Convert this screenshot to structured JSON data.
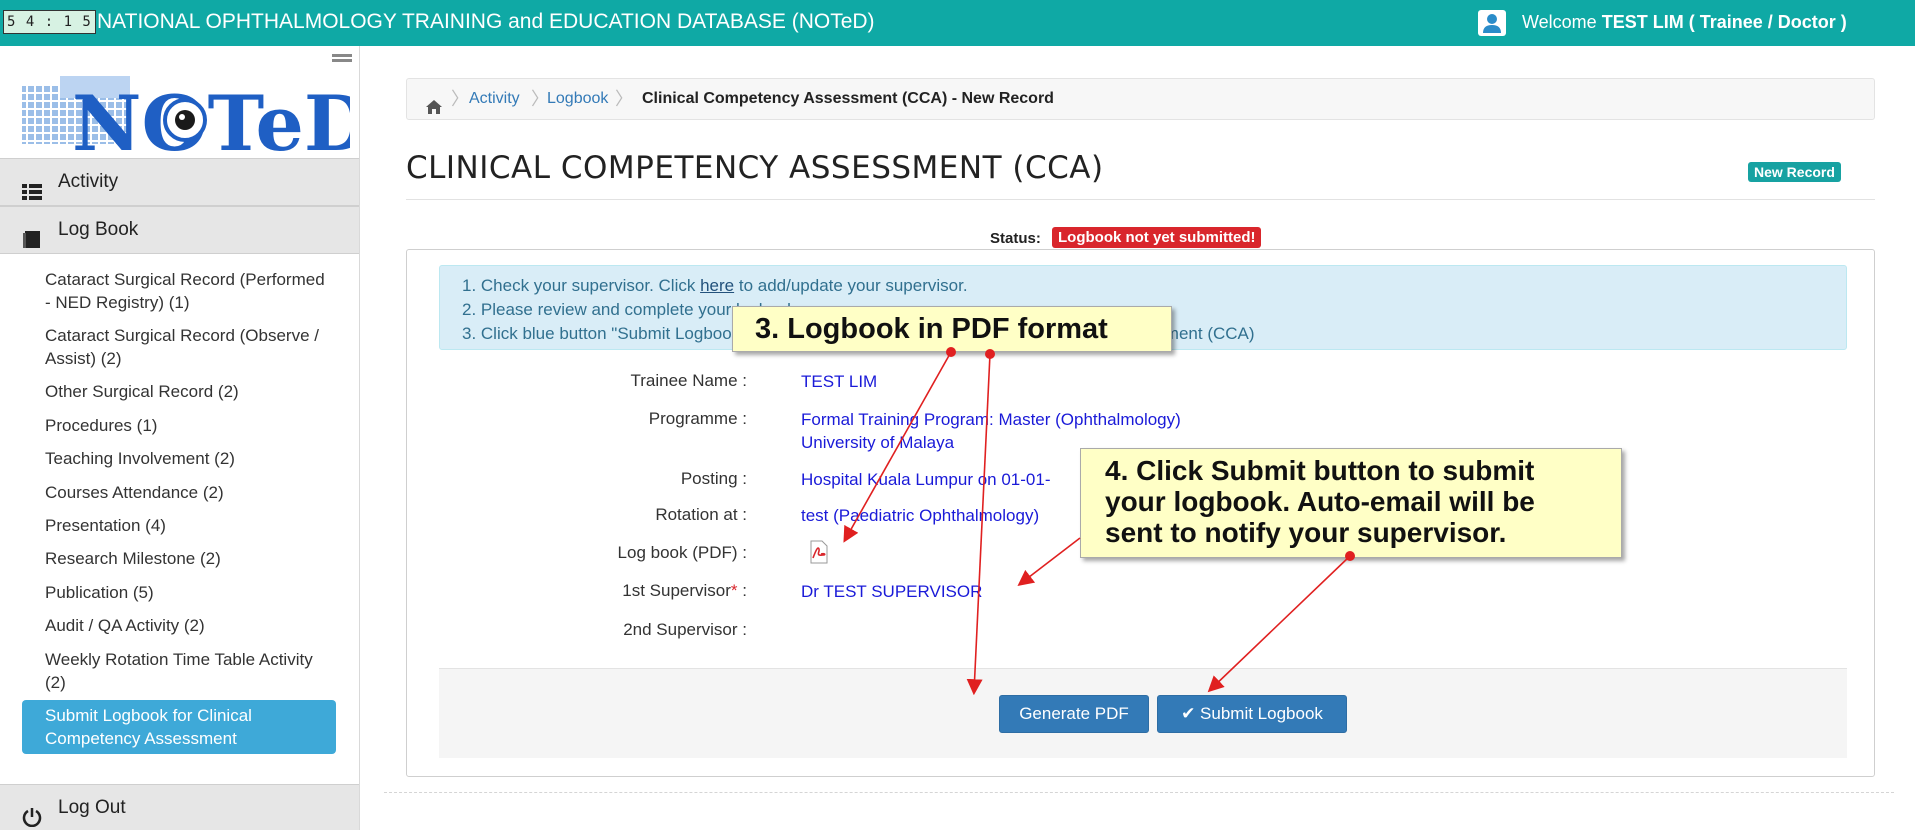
{
  "topbar": {
    "timer": "5 4 : 1 5",
    "app_title": "NATIONAL OPHTHALMOLOGY TRAINING and EDUCATION DATABASE (NOTeD)",
    "welcome_prefix": "Welcome",
    "welcome_user": "TEST LIM ( Trainee / Doctor )",
    "user_icon": "user-icon"
  },
  "sidebar": {
    "logo_text": "NOTeD",
    "activity_label": "Activity",
    "logbook_label": "Log Book",
    "logout_label": "Log Out",
    "items": [
      {
        "label": "Cataract Surgical Record (Performed - NED Registry) (1)"
      },
      {
        "label": "Cataract Surgical Record (Observe / Assist) (2)"
      },
      {
        "label": "Other Surgical Record (2)"
      },
      {
        "label": "Procedures (1)"
      },
      {
        "label": "Teaching Involvement (2)"
      },
      {
        "label": "Courses Attendance (2)"
      },
      {
        "label": "Presentation (4)"
      },
      {
        "label": "Research Milestone (2)"
      },
      {
        "label": "Publication (5)"
      },
      {
        "label": "Audit / QA Activity (2)"
      },
      {
        "label": "Weekly Rotation Time Table Activity (2)"
      },
      {
        "label": "Submit Logbook for Clinical Competency Assessment"
      }
    ]
  },
  "breadcrumb": {
    "activity": "Activity",
    "logbook": "Logbook",
    "current": "Clinical Competency Assessment (CCA) - New Record"
  },
  "page": {
    "title": "CLINICAL COMPETENCY ASSESSMENT (CCA)",
    "record_label": "New Record",
    "status_label": "Status:",
    "status_value": "Logbook not yet submitted!"
  },
  "instructions": {
    "line1_prefix": "1. Check your supervisor. Click ",
    "line1_link": "here",
    "line1_suffix": " to add/update your supervisor.",
    "line2": "2. Please review and complete your logbook.",
    "line3": "3. Click blue button \"Submit Logbook\" to submit your logbook for Clinical Competency Assessment (CCA)"
  },
  "form": {
    "trainee_label": "Trainee Name :",
    "trainee_value": "TEST LIM",
    "programme_label": "Programme :",
    "programme_value_1": "Formal Training Program: Master (Ophthalmology)",
    "programme_value_2": "University of Malaya",
    "posting_label": "Posting :",
    "posting_value": "Hospital Kuala Lumpur on 01-01-",
    "rotation_label": "Rotation at :",
    "rotation_value": "test (Paediatric Ophthalmology)",
    "logbook_label": "Log book (PDF) :",
    "supervisor1_label": "1st Supervisor",
    "supervisor1_required": "*",
    "supervisor1_value": "Dr TEST SUPERVISOR",
    "supervisor2_label": "2nd Supervisor :"
  },
  "buttons": {
    "generate_pdf": "Generate PDF",
    "submit_logbook": "Submit Logbook"
  },
  "callouts": {
    "pdf": "3. Logbook in PDF format",
    "submit": "4. Click Submit button to submit your logbook. Auto-email will be sent to notify your supervisor."
  },
  "colors": {
    "topbar": "#0fa9a5",
    "primary_button": "#337ab7",
    "danger_badge": "#d9262c",
    "active_menu": "#3ea9d8",
    "callout": "#ffffc6",
    "arrow": "#e02020"
  }
}
